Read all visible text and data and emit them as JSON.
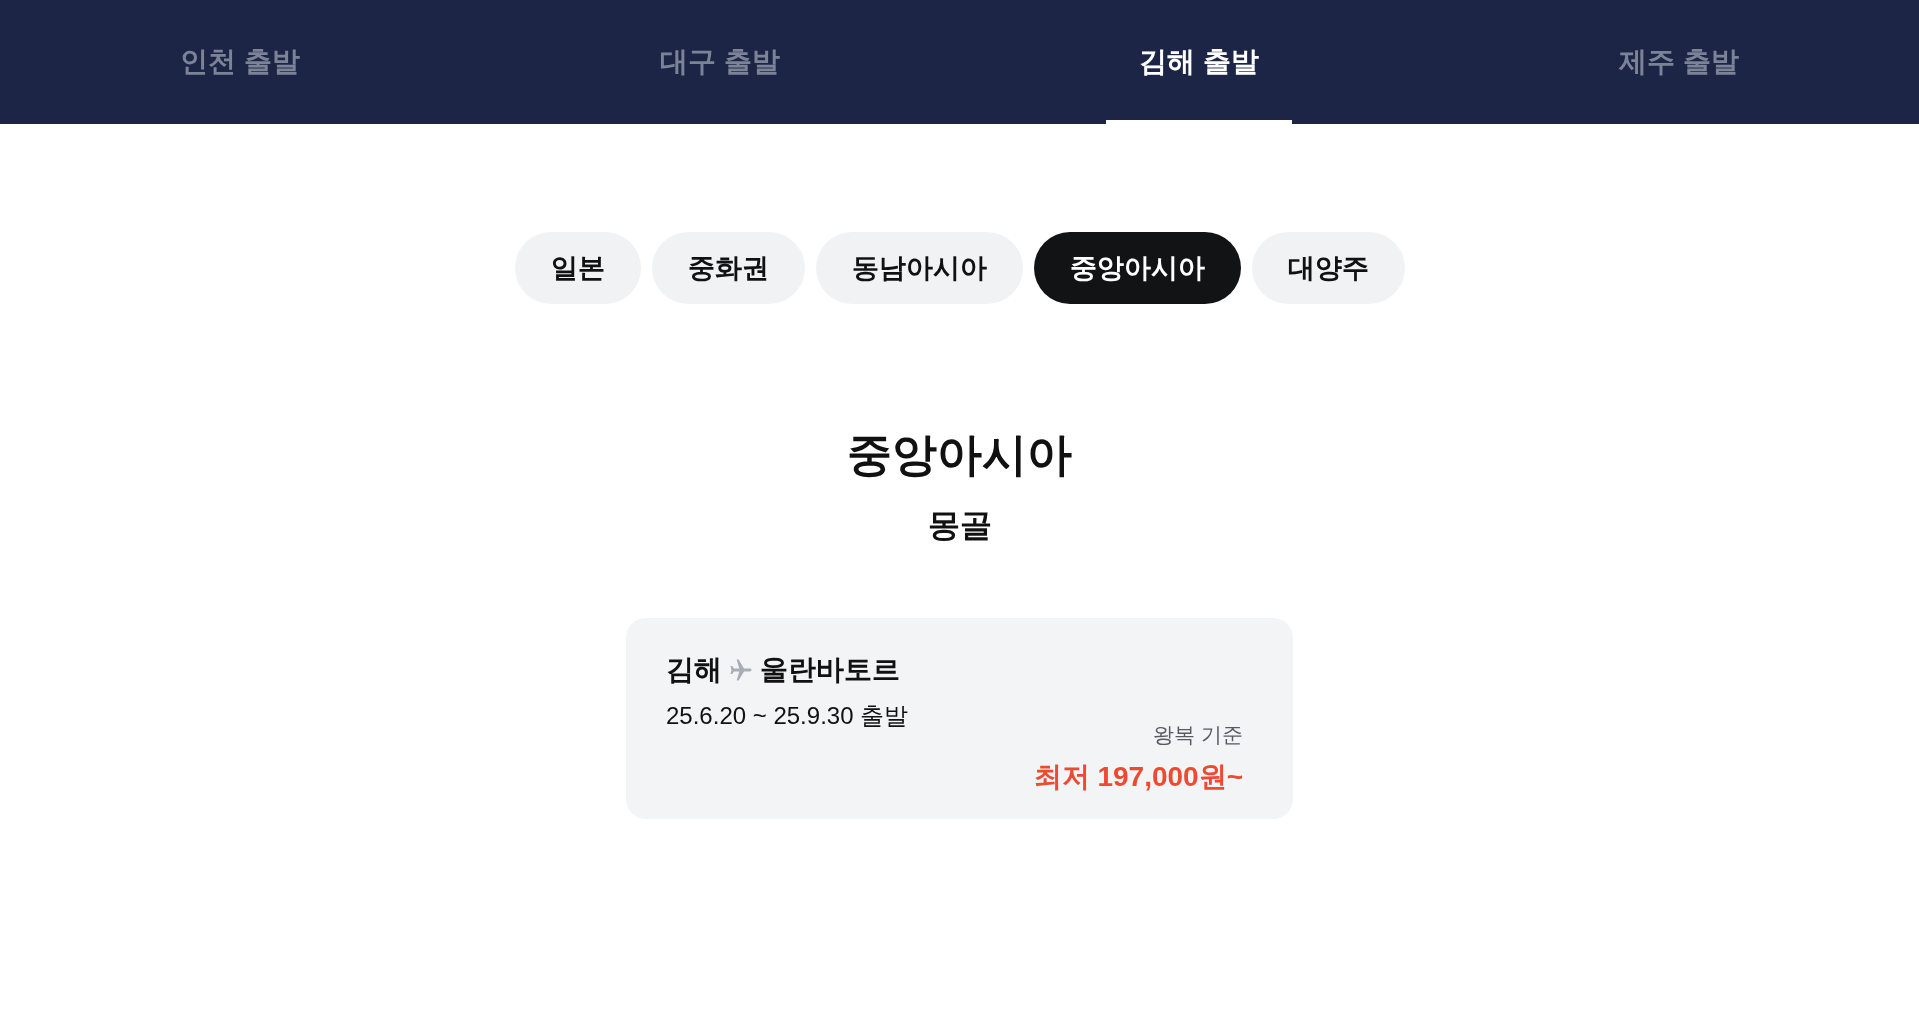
{
  "departure_tabs": [
    {
      "label": "인천 출발",
      "selected": false
    },
    {
      "label": "대구 출발",
      "selected": false
    },
    {
      "label": "김해 출발",
      "selected": true
    },
    {
      "label": "제주 출발",
      "selected": false
    }
  ],
  "region_filters": [
    {
      "label": "일본",
      "selected": false
    },
    {
      "label": "중화권",
      "selected": false
    },
    {
      "label": "동남아시아",
      "selected": false
    },
    {
      "label": "중앙아시아",
      "selected": true
    },
    {
      "label": "대양주",
      "selected": false
    }
  ],
  "section": {
    "title": "중앙아시아",
    "subtitle": "몽골"
  },
  "fares": [
    {
      "origin": "김해",
      "destination": "울란바토르",
      "period": "25.6.20 ~ 25.9.30 출발",
      "fare_basis": "왕복 기준",
      "price": "최저 197,000원~"
    }
  ]
}
